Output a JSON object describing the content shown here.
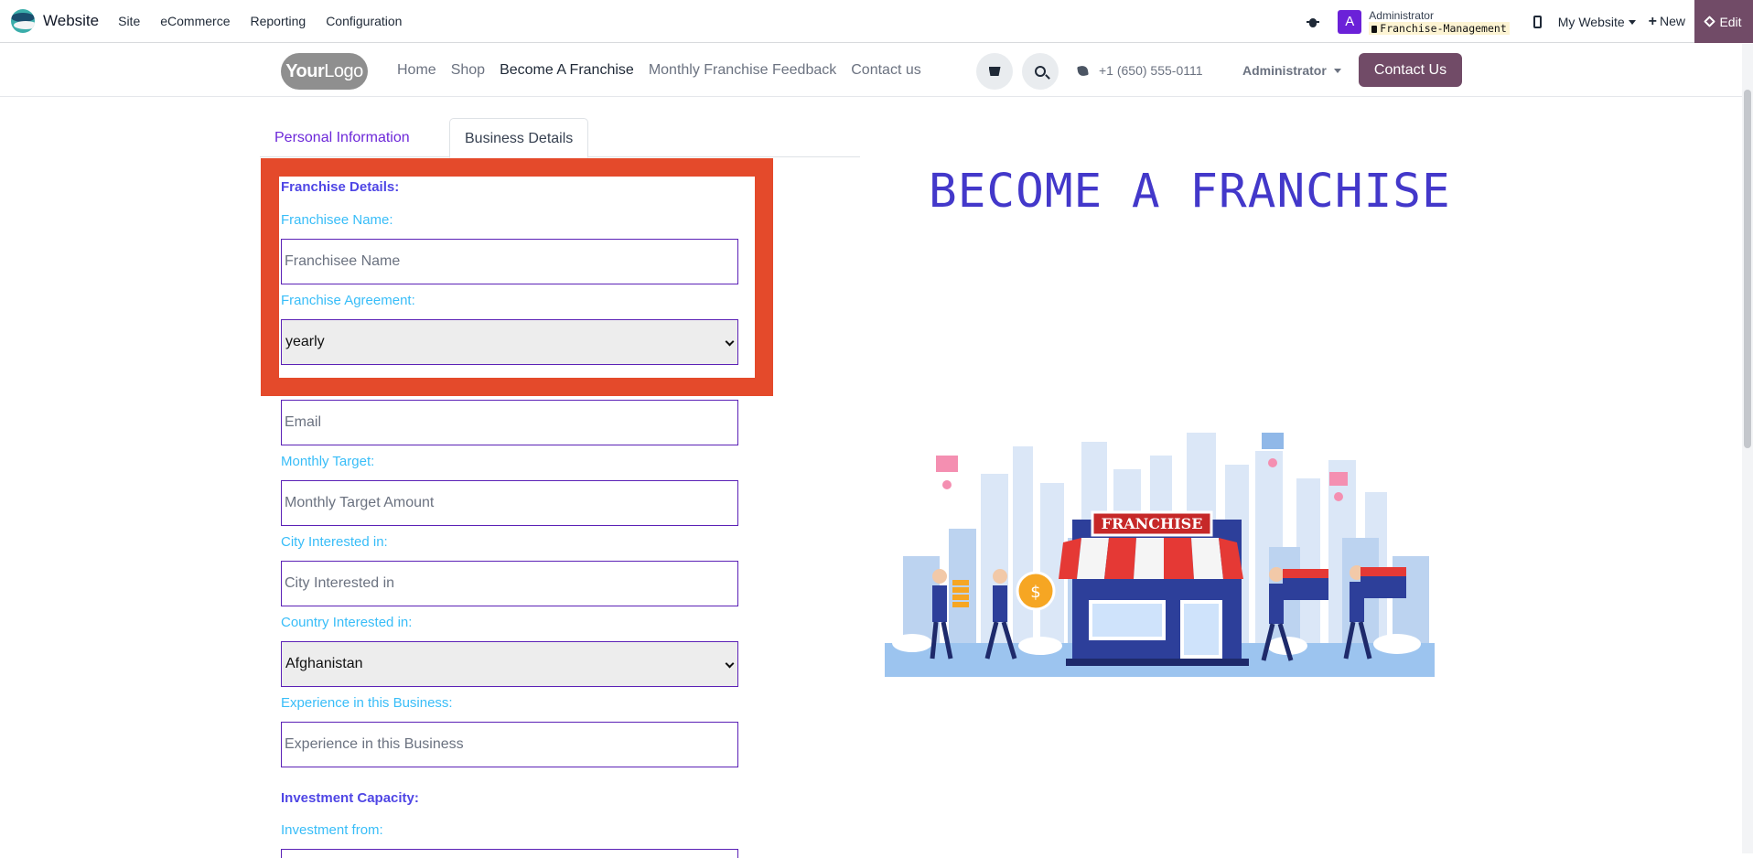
{
  "topbar": {
    "app_name": "Website",
    "menu": [
      "Site",
      "eCommerce",
      "Reporting",
      "Configuration"
    ],
    "avatar_letter": "A",
    "user_name": "Administrator",
    "database": "Franchise-Management",
    "my_website": "My Website",
    "new_label": "New",
    "edit_label": "Edit"
  },
  "site": {
    "logo_text_bold": "Your",
    "logo_text_light": "Logo",
    "nav": [
      "Home",
      "Shop",
      "Become A Franchise",
      "Monthly Franchise Feedback",
      "Contact us"
    ],
    "active_nav": "Become A Franchise",
    "phone": "+1 (650) 555-0111",
    "user_menu": "Administrator",
    "contact_button": "Contact Us"
  },
  "tabs": [
    "Personal Information",
    "Business Details"
  ],
  "active_tab": "Business Details",
  "form": {
    "section_franchise": "Franchise Details:",
    "franchisee_name_label": "Franchisee Name:",
    "franchisee_name_placeholder": "Franchisee Name",
    "agreement_label": "Franchise Agreement:",
    "agreement_value": "yearly",
    "email_placeholder": "Email",
    "monthly_target_label": "Monthly Target:",
    "monthly_target_placeholder": "Monthly Target Amount",
    "city_label": "City Interested in:",
    "city_placeholder": "City Interested in",
    "country_label": "Country Interested in:",
    "country_value": "Afghanistan",
    "experience_label": "Experience in this Business:",
    "experience_placeholder": "Experience in this Business",
    "section_investment": "Investment Capacity:",
    "investment_from_label": "Investment from:"
  },
  "hero": {
    "title": "BECOME A FRANCHISE",
    "sign_text": "FRANCHISE"
  },
  "colors": {
    "brand": "#714b67",
    "highlight": "#e44a2b",
    "section": "#4f46e5",
    "label": "#38bdf8",
    "hero_title": "#4338ca"
  }
}
